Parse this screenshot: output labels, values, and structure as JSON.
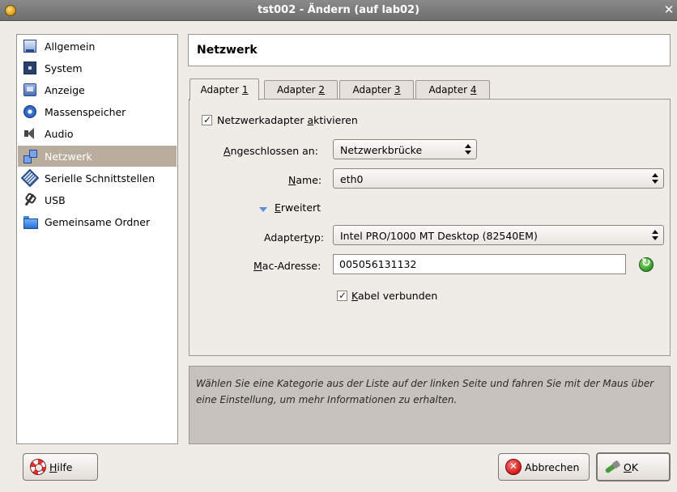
{
  "window": {
    "title": "tst002 - Ändern (auf lab02)",
    "close_glyph": "✕"
  },
  "sidebar": {
    "items": [
      {
        "label": "Allgemein",
        "icon": "general-icon"
      },
      {
        "label": "System",
        "icon": "system-icon"
      },
      {
        "label": "Anzeige",
        "icon": "display-icon"
      },
      {
        "label": "Massenspeicher",
        "icon": "storage-icon"
      },
      {
        "label": "Audio",
        "icon": "audio-icon"
      },
      {
        "label": "Netzwerk",
        "icon": "network-icon",
        "selected": true
      },
      {
        "label": "Serielle Schnittstellen",
        "icon": "serial-port-icon"
      },
      {
        "label": "USB",
        "icon": "usb-icon"
      },
      {
        "label": "Gemeinsame Ordner",
        "icon": "shared-folder-icon"
      }
    ],
    "selected_color": "#b9ad9d"
  },
  "page": {
    "title": "Netzwerk"
  },
  "tabs": [
    {
      "prefix": "Adapter ",
      "mnemonic": "1"
    },
    {
      "prefix": "Adapter ",
      "mnemonic": "2"
    },
    {
      "prefix": "Adapter ",
      "mnemonic": "3"
    },
    {
      "prefix": "Adapter ",
      "mnemonic": "4"
    }
  ],
  "adapter": {
    "enable": {
      "checked": true,
      "glyph": "✓",
      "label_pre": "Netzwerkadapter ",
      "label_mn": "a",
      "label_post": "ktivieren"
    },
    "attached": {
      "label_mn": "A",
      "label_post": "ngeschlossen an:",
      "value": "Netzwerkbrücke"
    },
    "name": {
      "label_mn": "N",
      "label_post": "ame:",
      "value": "eth0"
    },
    "advanced": {
      "label_mn": "E",
      "label_post": "rweitert",
      "expanded": true
    },
    "adapter_type": {
      "label_pre": "Adapter",
      "label_mn": "t",
      "label_post": "yp:",
      "value": "Intel PRO/1000 MT Desktop (82540EM)"
    },
    "mac": {
      "label_mn": "M",
      "label_post": "ac-Adresse:",
      "value": "005056131132"
    },
    "cable": {
      "checked": true,
      "glyph": "✓",
      "label_mn": "K",
      "label_post": "abel verbunden"
    }
  },
  "info": {
    "text": "Wählen Sie eine Kategorie aus der Liste auf der linken Seite und fahren Sie mit der Maus über eine Einstellung, um mehr Informationen zu erhalten."
  },
  "buttons": {
    "help": {
      "mn": "H",
      "rest": "ilfe"
    },
    "cancel": {
      "label": "Abbrechen"
    },
    "ok": {
      "mn": "O",
      "rest": "K"
    }
  }
}
